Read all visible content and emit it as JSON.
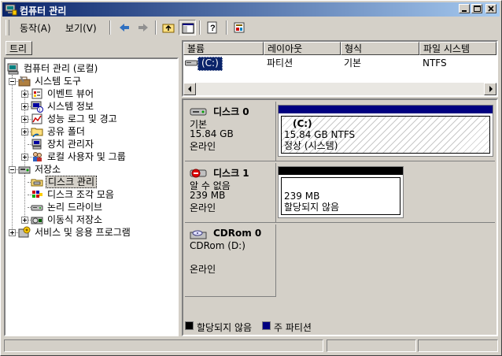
{
  "window": {
    "title": "컴퓨터 관리"
  },
  "menu": {
    "action": "동작(A)",
    "view": "보기(V)"
  },
  "tree": {
    "tab": "트리",
    "nodes": [
      "컴퓨터 관리 (로컬)",
      "시스템 도구",
      "이벤트 뷰어",
      "시스템 정보",
      "성능 로그 및 경고",
      "공유 폴더",
      "장치 관리자",
      "로컬 사용자 및 그룹",
      "저장소",
      "디스크 관리",
      "디스크 조각 모음",
      "논리 드라이브",
      "이동식 저장소",
      "서비스 및 응용 프로그램"
    ]
  },
  "volumes": {
    "columns": [
      "볼륨",
      "레이아웃",
      "형식",
      "파일 시스템"
    ],
    "rows": [
      {
        "volume": "(C:)",
        "layout": "파티션",
        "type": "기본",
        "fs": "NTFS"
      }
    ]
  },
  "disks": [
    {
      "name": "디스크 0",
      "type": "기본",
      "size": "15.84 GB",
      "status": "온라인",
      "partition": {
        "label": "(C:)",
        "size": "15.84 GB NTFS",
        "status": "정상 (시스템)"
      }
    },
    {
      "name": "디스크 1",
      "type": "알 수 없음",
      "size": "239 MB",
      "status": "온라인",
      "partition": {
        "size": "239 MB",
        "status": "할당되지 않음"
      }
    },
    {
      "name": "CDRom 0",
      "type": "CDRom (D:)",
      "status": "온라인"
    }
  ],
  "legend": [
    {
      "label": "할당되지 않음",
      "color": "#000000"
    },
    {
      "label": "주 파티션",
      "color": "#000080"
    }
  ],
  "colors": {
    "titlebar_start": "#0a246a",
    "titlebar_end": "#a6caf0",
    "primary_partition": "#000080",
    "unallocated": "#000000"
  }
}
